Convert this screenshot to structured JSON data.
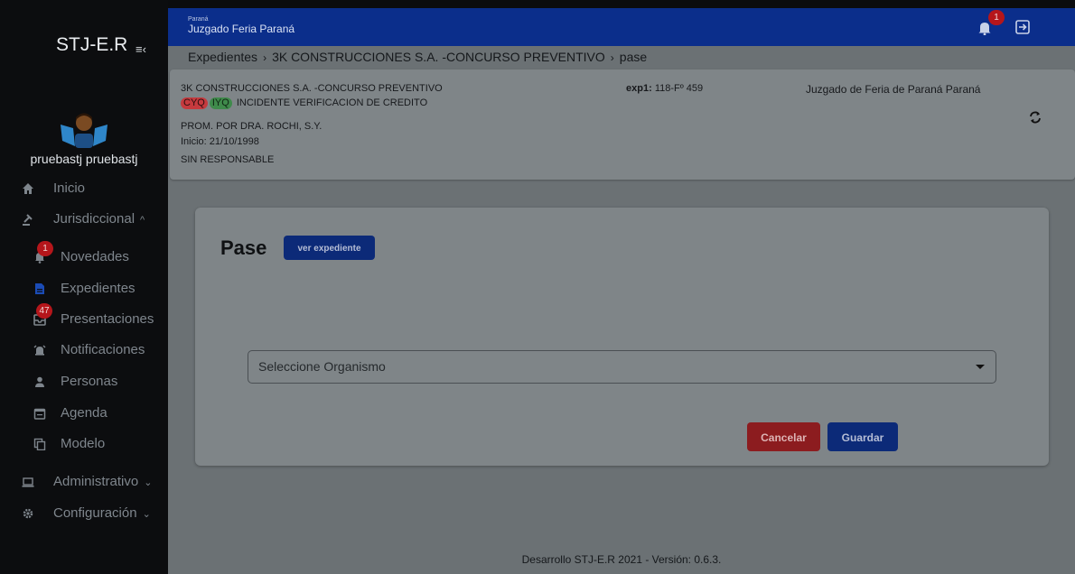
{
  "app": {
    "brand": "STJ-E.R",
    "menu_icon": "menu-collapse-icon"
  },
  "user": {
    "name": "pruebastj pruebastj"
  },
  "sidebar": {
    "items": [
      {
        "label": "Inicio",
        "icon": "home-icon"
      },
      {
        "label": "Jurisdiccional",
        "icon": "gavel-icon",
        "chevron": "^"
      },
      {
        "label": "Novedades",
        "icon": "bell-icon",
        "badge": "1"
      },
      {
        "label": "Expedientes",
        "icon": "document-icon"
      },
      {
        "label": "Presentaciones",
        "icon": "inbox-icon",
        "badge": "47"
      },
      {
        "label": "Notificaciones",
        "icon": "alarm-icon"
      },
      {
        "label": "Personas",
        "icon": "person-icon"
      },
      {
        "label": "Agenda",
        "icon": "calendar-icon"
      },
      {
        "label": "Modelo",
        "icon": "copy-icon"
      },
      {
        "label": "Administrativo",
        "icon": "laptop-icon",
        "chevron": "⌄"
      },
      {
        "label": "Configuración",
        "icon": "gear-icon",
        "chevron": "⌄"
      }
    ]
  },
  "topbar": {
    "small": "Paraná",
    "title": "Juzgado Feria Paraná",
    "notification_count": "1"
  },
  "breadcrumb": [
    "Expedientes",
    "3K CONSTRUCCIONES S.A. -CONCURSO PREVENTIVO",
    "pase"
  ],
  "case": {
    "title": "3K CONSTRUCCIONES S.A. -CONCURSO PREVENTIVO",
    "tags": [
      "CYQ",
      "IYQ"
    ],
    "subtitle": "INCIDENTE VERIFICACION DE CREDITO",
    "prom": "PROM. POR DRA. ROCHI, S.Y.",
    "inicio": "Inicio: 21/10/1998",
    "responsable": "SIN RESPONSABLE",
    "exp_label": "exp1:",
    "exp_value": "118-Fº 459",
    "juzgado": "Juzgado de Feria de Paraná Paraná"
  },
  "pase": {
    "title": "Pase",
    "ver_button": "ver expediente",
    "select_placeholder": "Seleccione Organismo",
    "cancel": "Cancelar",
    "save": "Guardar"
  },
  "footer": "Desarrollo STJ-E.R 2021 - Versión: 0.6.3.",
  "colors": {
    "topbar": "#0b2e8b",
    "sidebar": "#0c0d0f",
    "danger": "#8c1c1f",
    "primary": "#0c2a78"
  }
}
